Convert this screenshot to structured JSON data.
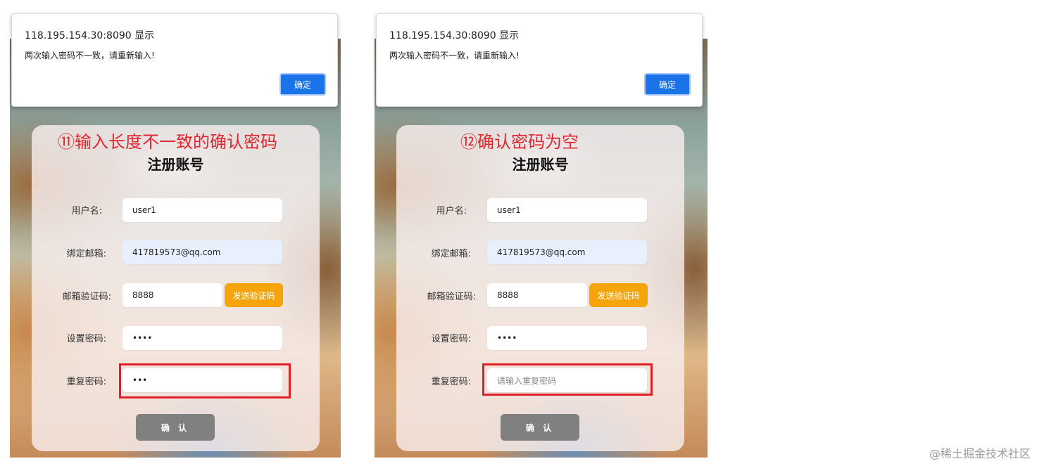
{
  "dialog": {
    "title": "118.195.154.30:8090 显示",
    "message": "两次输入密码不一致，请重新输入!",
    "ok_label": "确定",
    "accent_color": "#1a73e8"
  },
  "form": {
    "title": "注册账号",
    "username_label": "用户名:",
    "email_label": "绑定邮箱:",
    "code_label": "邮箱验证码:",
    "password_label": "设置密码:",
    "repeat_label": "重复密码:",
    "send_code_label": "发送验证码",
    "submit_label": "确 认",
    "username_value": "user1",
    "email_value": "417819573@qq.com",
    "code_value": "8888",
    "password_value": "••••",
    "repeat_placeholder": "请输入重复密码"
  },
  "panels": [
    {
      "annotation": "⑪输入长度不一致的确认密码",
      "repeat_value": "•••"
    },
    {
      "annotation": "⑫确认密码为空",
      "repeat_value": ""
    }
  ],
  "colors": {
    "highlight": "#e01f2a",
    "send_button": "#f5a40c",
    "submit_button": "#808080"
  },
  "watermark": "@稀土掘金技术社区"
}
